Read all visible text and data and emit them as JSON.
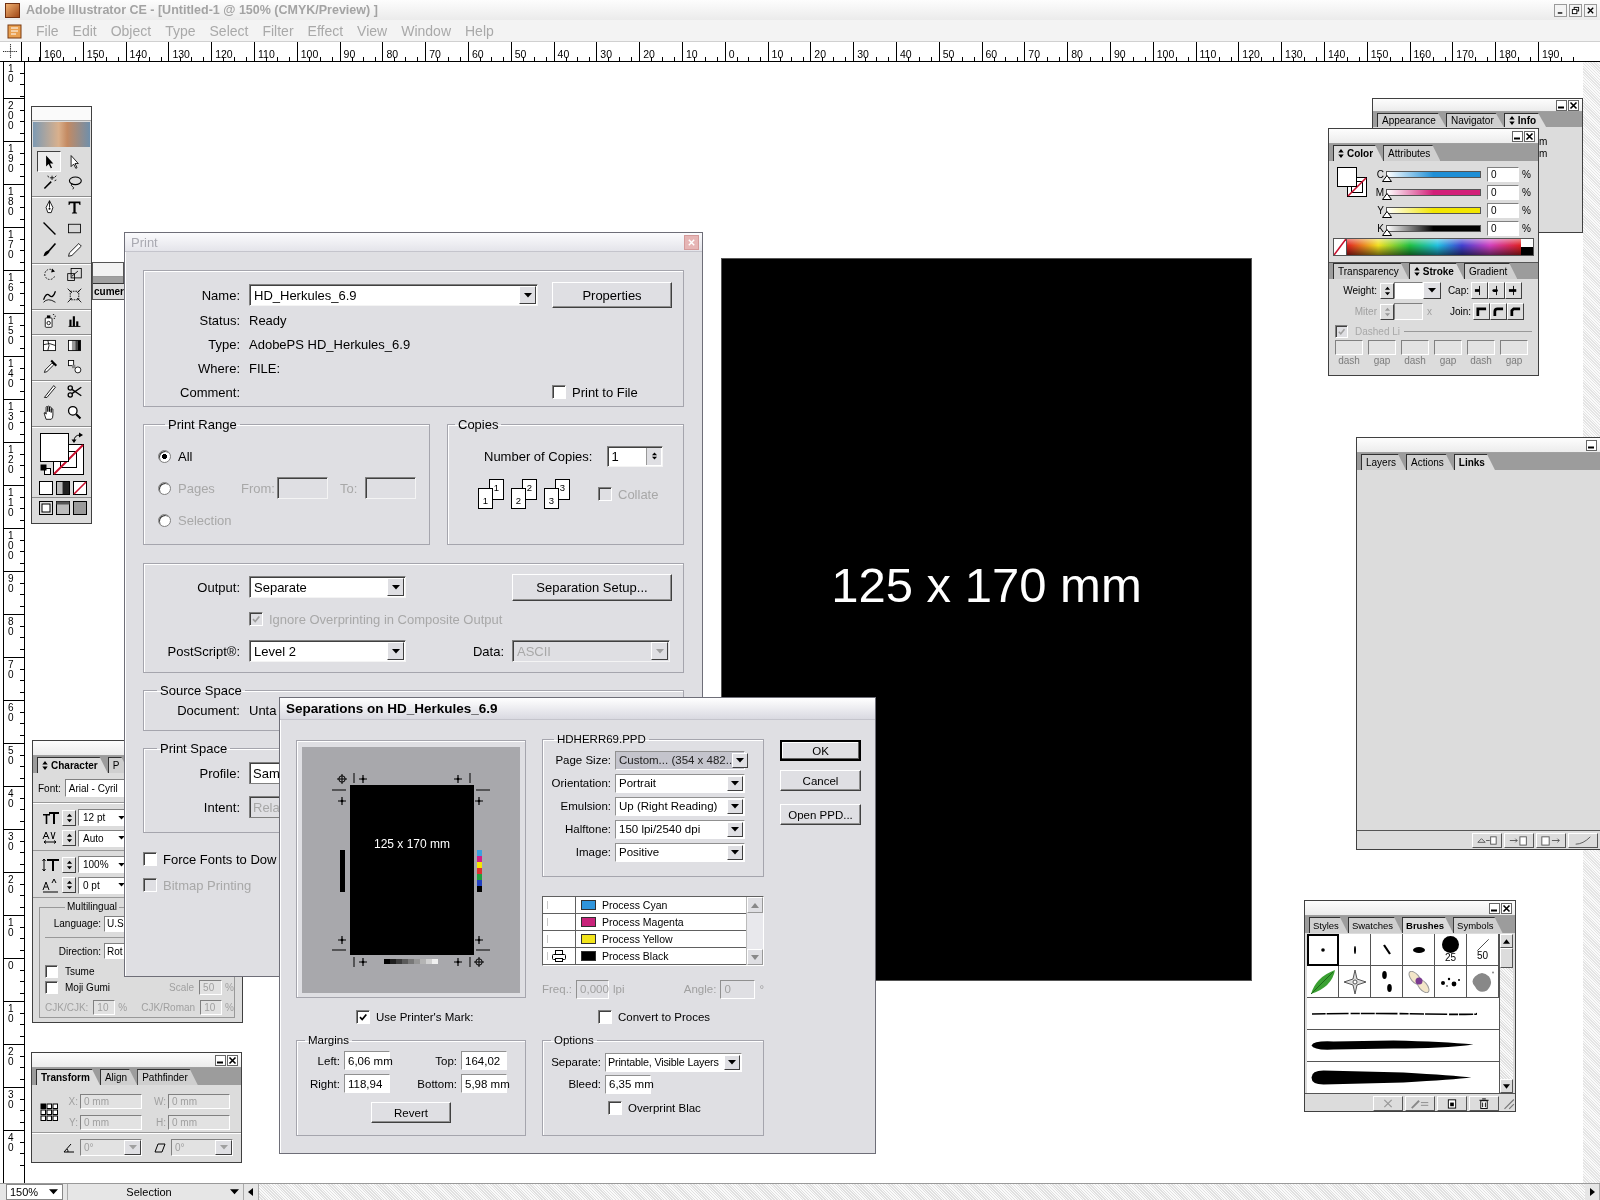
{
  "window": {
    "title": "Adobe Illustrator CE - [Untitled-1 @ 150% (CMYK/Preview) ]",
    "active": false
  },
  "menu": [
    "File",
    "Edit",
    "Object",
    "Type",
    "Select",
    "Filter",
    "Effect",
    "View",
    "Window",
    "Help"
  ],
  "rulers": {
    "horizontal": [
      "160",
      "150",
      "140",
      "130",
      "120",
      "110",
      "100",
      "90",
      "80",
      "70",
      "60",
      "50",
      "40",
      "30",
      "20",
      "10",
      "0",
      "10",
      "20",
      "30",
      "40",
      "50",
      "60",
      "70",
      "80",
      "90",
      "100",
      "110",
      "120",
      "130",
      "140",
      "150",
      "160",
      "170",
      "180",
      "190"
    ],
    "vertical": [
      "10",
      "200",
      "190",
      "180",
      "170",
      "160",
      "150",
      "140",
      "130",
      "120",
      "110",
      "100",
      "90",
      "80",
      "70",
      "60",
      "50",
      "40",
      "30",
      "20",
      "10",
      "0",
      "10",
      "20",
      "30",
      "40"
    ]
  },
  "toolbox": {
    "tools": [
      {
        "kind": "selection",
        "selected": true
      },
      {
        "kind": "direct-selection",
        "selected": false
      },
      {
        "kind": "magic-wand",
        "selected": false
      },
      {
        "kind": "lasso",
        "selected": false
      },
      {
        "kind": "pen",
        "selected": false
      },
      {
        "kind": "type",
        "selected": false
      },
      {
        "kind": "line",
        "selected": false
      },
      {
        "kind": "rectangle",
        "selected": false
      },
      {
        "kind": "paintbrush",
        "selected": false
      },
      {
        "kind": "pencil",
        "selected": false
      },
      {
        "kind": "rotate",
        "selected": false
      },
      {
        "kind": "scale",
        "selected": false
      },
      {
        "kind": "warp",
        "selected": false
      },
      {
        "kind": "free-transform",
        "selected": false
      },
      {
        "kind": "symbol-sprayer",
        "selected": false
      },
      {
        "kind": "graph",
        "selected": false
      },
      {
        "kind": "mesh",
        "selected": false
      },
      {
        "kind": "gradient",
        "selected": false
      },
      {
        "kind": "eyedropper",
        "selected": false
      },
      {
        "kind": "blend",
        "selected": false
      },
      {
        "kind": "slice",
        "selected": false
      },
      {
        "kind": "scissors",
        "selected": false
      },
      {
        "kind": "hand",
        "selected": false
      },
      {
        "kind": "zoom",
        "selected": false
      }
    ],
    "fill": {
      "color": "#ffffff"
    },
    "stroke": {
      "none": true
    }
  },
  "docked_palette_tab": {
    "label": "cumer"
  },
  "artboard": {
    "label": "125 x 170 mm"
  },
  "print_dialog": {
    "title": "Print",
    "active": false,
    "printer": {
      "name_label": "Name:",
      "name": "HD_Herkules_6.9",
      "properties_button": "Properties",
      "status_label": "Status:",
      "status": "Ready",
      "type_label": "Type:",
      "type": "AdobePS HD_Herkules_6.9",
      "where_label": "Where:",
      "where": "FILE:",
      "comment_label": "Comment:",
      "print_to_file": {
        "label": "Print to File",
        "checked": false
      }
    },
    "print_range": {
      "title": "Print Range",
      "options": [
        {
          "label": "All",
          "selected": true,
          "disabled": false
        },
        {
          "label": "Pages",
          "selected": false,
          "disabled": true
        },
        {
          "label": "Selection",
          "selected": false,
          "disabled": true
        }
      ],
      "from_label": "From:",
      "to_label": "To:"
    },
    "copies": {
      "title": "Copies",
      "label": "Number of Copies:",
      "value": "1",
      "collate_pages": [
        "1",
        "1",
        "2",
        "2",
        "3",
        "3"
      ],
      "collate": {
        "label": "Collate",
        "checked": false,
        "disabled": true
      }
    },
    "output": {
      "output_label": "Output:",
      "output": "Separate",
      "separation_setup_button": "Separation Setup...",
      "ignore_overprinting": {
        "label": "Ignore Overprinting in Composite Output",
        "checked": true,
        "disabled": true
      },
      "postscript_label": "PostScript®:",
      "postscript": "Level 2",
      "data_label": "Data:",
      "data": "ASCII",
      "data_disabled": true
    },
    "source_space": {
      "title": "Source Space",
      "document_label": "Document:",
      "document": "Unta"
    },
    "print_space": {
      "title": "Print Space",
      "profile_label": "Profile:",
      "profile": "Sam",
      "intent_label": "Intent:",
      "intent": "Rela",
      "intent_disabled": true
    },
    "checkboxes": [
      {
        "label": "Force Fonts to Dow",
        "checked": false,
        "disabled": false
      },
      {
        "label": "Bitmap Printing",
        "checked": false,
        "disabled": true
      }
    ]
  },
  "separations_dialog": {
    "title": "Separations on HD_Herkules_6.9",
    "active": true,
    "preview": {
      "label": "125 x 170 mm"
    },
    "use_printers_marks": {
      "label": "Use Printer's Mark:",
      "checked": true
    },
    "margins": {
      "title": "Margins",
      "fields": [
        {
          "label": "Left:",
          "value": "6,06 mm"
        },
        {
          "label": "Top:",
          "value": "164,02"
        },
        {
          "label": "Right:",
          "value": "118,94"
        },
        {
          "label": "Bottom:",
          "value": "5,98 mm"
        }
      ],
      "revert_button": "Revert"
    },
    "ppd": {
      "title": "HDHERR69.PPD",
      "fields": [
        {
          "label": "Page Size:",
          "value": "Custom... (354 x 482..",
          "highlighted": true
        },
        {
          "label": "Orientation:",
          "value": "Portrait",
          "highlighted": false
        },
        {
          "label": "Emulsion:",
          "value": "Up (Right Reading)",
          "highlighted": false
        },
        {
          "label": "Halftone:",
          "value": "150 lpi/2540 dpi",
          "highlighted": false
        },
        {
          "label": "Image:",
          "value": "Positive",
          "highlighted": false
        }
      ]
    },
    "inks": [
      {
        "name": "Process Cyan",
        "color": "#2f95dc",
        "print": false
      },
      {
        "name": "Process Magenta",
        "color": "#c8237a",
        "print": false
      },
      {
        "name": "Process Yellow",
        "color": "#f2e41a",
        "print": false
      },
      {
        "name": "Process Black",
        "color": "#000000",
        "print": true
      }
    ],
    "frequency": {
      "label": "Freq.:",
      "value": "0,000",
      "unit": "lpi",
      "disabled": true
    },
    "angle": {
      "label": "Angle:",
      "value": "0",
      "unit": "°",
      "disabled": true
    },
    "convert_to_process": {
      "label": "Convert to Proces",
      "checked": false
    },
    "options": {
      "title": "Options",
      "separate_label": "Separate:",
      "separate": "Printable, Visible Layers",
      "bleed_label": "Bleed:",
      "bleed": "6,35 mm",
      "overprint_black": {
        "label": "Overprint Blac",
        "checked": false
      }
    },
    "buttons": [
      {
        "label": "OK",
        "default": true
      },
      {
        "label": "Cancel",
        "default": false
      },
      {
        "label": "Open PPD...",
        "default": false
      }
    ]
  },
  "info_palette": {
    "tabs": [
      {
        "label": "Appearance",
        "selected": false,
        "toggle": false
      },
      {
        "label": "Navigator",
        "selected": false,
        "toggle": false
      },
      {
        "label": "Info",
        "selected": true,
        "toggle": true
      }
    ],
    "readouts": [
      "m",
      "m"
    ]
  },
  "color_palette": {
    "tabs": [
      {
        "label": "Color",
        "selected": true,
        "toggle": true
      },
      {
        "label": "Attributes",
        "selected": false,
        "toggle": false
      }
    ],
    "fill": {
      "color": "#ffffff"
    },
    "stroke": {
      "none": true
    },
    "channels": [
      {
        "name": "C",
        "level": 0,
        "value": "0",
        "unit": "%",
        "color": "#1f8fd6"
      },
      {
        "name": "M",
        "level": 0,
        "value": "0",
        "unit": "%",
        "color": "#d21f78"
      },
      {
        "name": "Y",
        "level": 0,
        "value": "0",
        "unit": "%",
        "color": "#f2e600"
      },
      {
        "name": "K",
        "level": 0,
        "value": "0",
        "unit": "%",
        "color": "#000000"
      }
    ]
  },
  "stroke_palette": {
    "tabs": [
      {
        "label": "Transparency",
        "selected": false,
        "toggle": false
      },
      {
        "label": "Stroke",
        "selected": true,
        "toggle": true
      },
      {
        "label": "Gradient",
        "selected": false,
        "toggle": false
      }
    ],
    "weight_label": "Weight:",
    "cap_label": "Cap:",
    "miter_label": "Miter",
    "miter_unit": "x",
    "miter_disabled": true,
    "join_label": "Join:",
    "dashed_line": {
      "label": "Dashed Li",
      "checked": true,
      "disabled": true
    },
    "dash_labels": [
      "dash",
      "gap",
      "dash",
      "gap",
      "dash",
      "gap"
    ]
  },
  "layers_palette": {
    "tabs": [
      {
        "label": "Layers",
        "selected": false
      },
      {
        "label": "Actions",
        "selected": false
      },
      {
        "label": "Links",
        "selected": true
      }
    ]
  },
  "brushes_palette": {
    "tabs": [
      {
        "label": "Styles",
        "selected": false
      },
      {
        "label": "Swatches",
        "selected": false
      },
      {
        "label": "Brushes",
        "selected": true
      },
      {
        "label": "Symbols",
        "selected": false
      }
    ],
    "brushes": [
      {
        "kind": "dot",
        "selected": true
      },
      {
        "kind": "tick",
        "selected": false
      },
      {
        "kind": "slash",
        "selected": false
      },
      {
        "kind": "oval",
        "selected": false
      },
      {
        "kind": "round",
        "size": "25",
        "selected": false
      },
      {
        "kind": "hairline",
        "size": "50",
        "selected": false
      },
      {
        "kind": "leaf",
        "selected": false
      },
      {
        "kind": "star",
        "selected": false
      },
      {
        "kind": "footprints",
        "selected": false
      },
      {
        "kind": "flower",
        "selected": false
      },
      {
        "kind": "splatter",
        "selected": false
      },
      {
        "kind": "blob",
        "selected": false
      },
      {
        "kind": "dry-ink",
        "selected": false
      },
      {
        "kind": "charcoal",
        "selected": false
      },
      {
        "kind": "tapered",
        "selected": false
      }
    ]
  },
  "character_palette": {
    "tabs": [
      {
        "label": "Character",
        "selected": true,
        "toggle": true
      },
      {
        "label": "P",
        "selected": false,
        "toggle": false
      }
    ],
    "font_label": "Font:",
    "font": "Arial - Cyril",
    "fields": [
      {
        "kind": "size",
        "value": "12 pt"
      },
      {
        "kind": "kerning",
        "value": "Auto"
      },
      {
        "kind": "leading",
        "value": "100%"
      },
      {
        "kind": "baseline",
        "value": "0 pt"
      }
    ],
    "multilingual": {
      "title": "Multilingual",
      "language_label": "Language:",
      "language": "U.S",
      "direction_label": "Direction:",
      "direction": "Rot",
      "tsume": {
        "label": "Tsume",
        "checked": false
      },
      "moji_gumi": {
        "label": "Moji Gumi",
        "checked": false
      },
      "scale_label": "Scale",
      "scale": "50",
      "scale_unit": "%",
      "cjk_cjk_label": "CJK/CJK:",
      "cjk_cjk": "10",
      "cjk_cjk_unit": "%",
      "cjk_roman_label": "CJK/Roman",
      "cjk_roman": "10",
      "cjk_roman_unit": "%",
      "cjk_disabled": true
    }
  },
  "transform_palette": {
    "tabs": [
      {
        "label": "Transform",
        "selected": true
      },
      {
        "label": "Align",
        "selected": false
      },
      {
        "label": "Pathfinder",
        "selected": false
      }
    ],
    "fields": [
      {
        "label": "X:",
        "value": "0 mm"
      },
      {
        "label": "W:",
        "value": "0 mm"
      },
      {
        "label": "Y:",
        "value": "0 mm"
      },
      {
        "label": "H:",
        "value": "0 mm"
      }
    ],
    "rotate": "0°",
    "shear": "0°",
    "disabled": true
  },
  "status_bar": {
    "zoom": "150%",
    "status": "Selection"
  }
}
